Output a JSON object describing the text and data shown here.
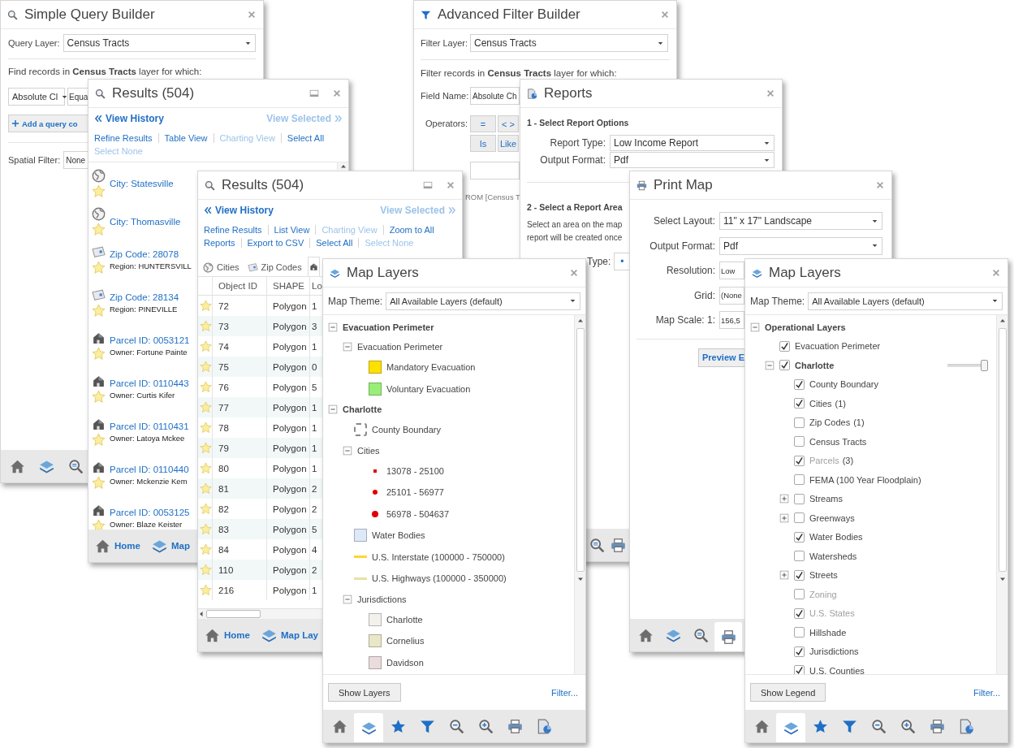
{
  "simple_query_builder": {
    "title": "Simple Query Builder",
    "layer_label": "Query Layer:",
    "layer": "Census Tracts",
    "intro": "Find records in **Census Tracts** layer for which:",
    "field": "Absolute Cl",
    "operator": "Equa",
    "add_button": "Add a query co",
    "spatial_label": "Spatial Filter:",
    "spatial": "None",
    "toolbar": [
      {
        "kind": "home",
        "selected": false
      },
      {
        "kind": "layers",
        "selected": false
      },
      {
        "kind": "zoom",
        "selected": false
      }
    ]
  },
  "results_list": {
    "title": "Results (504)",
    "history": "View History",
    "view_selected": "View Selected",
    "action_rows": [
      [
        {
          "label": "Refine Results",
          "disabled": false
        },
        {
          "label": "Table View",
          "disabled": false
        },
        {
          "label": "Charting View",
          "disabled": true
        },
        {
          "label": "Select All",
          "disabled": false
        }
      ],
      [
        {
          "label": "Select None",
          "disabled": true
        }
      ]
    ],
    "items": [
      {
        "kind": "city",
        "title": "City: Statesville"
      },
      {
        "kind": "city",
        "title": "City: Thomasville"
      },
      {
        "kind": "zip",
        "title": "Zip Code: 28078",
        "detail": "Region: HUNTERSVILL"
      },
      {
        "kind": "zip",
        "title": "Zip Code: 28134",
        "detail": "Region: PINEVILLE"
      },
      {
        "kind": "parcel",
        "title": "Parcel ID: 0053121",
        "detail": "Owner: Fortune Painte"
      },
      {
        "kind": "parcel",
        "title": "Parcel ID: 0110443",
        "detail": "Owner: Curtis Kifer"
      },
      {
        "kind": "parcel",
        "title": "Parcel ID: 0110431",
        "detail": "Owner: Latoya Mckee"
      },
      {
        "kind": "parcel",
        "title": "Parcel ID: 0110440",
        "detail": "Owner: Mckenzie Kem"
      },
      {
        "kind": "parcel",
        "title": "Parcel ID: 0053125",
        "detail": "Owner: Blaze Keister"
      }
    ],
    "toolbar": [
      {
        "kind": "home",
        "label": "Home"
      },
      {
        "kind": "layers",
        "label": "Map"
      }
    ]
  },
  "results_table": {
    "title": "Results (504)",
    "history": "View History",
    "view_selected": "View Selected",
    "action_rows": [
      [
        {
          "label": "Refine Results",
          "disabled": false
        },
        {
          "label": "List View",
          "disabled": false
        },
        {
          "label": "Charting View",
          "disabled": true
        },
        {
          "label": "Zoom to All",
          "disabled": false
        }
      ],
      [
        {
          "label": "Reports",
          "disabled": false
        },
        {
          "label": "Export to CSV",
          "disabled": false
        },
        {
          "label": "Select All",
          "disabled": false
        },
        {
          "label": "Select None",
          "disabled": true
        }
      ]
    ],
    "tabs": [
      {
        "kind": "city",
        "label": "Cities",
        "selected": false
      },
      {
        "kind": "zip",
        "label": "Zip Codes",
        "selected": false
      },
      {
        "kind": "parcel",
        "selected": true
      }
    ],
    "columns": [
      "Object ID",
      "SHAPE",
      "Lo"
    ],
    "rows": [
      [
        "72",
        "Polygon",
        "1"
      ],
      [
        "73",
        "Polygon",
        "3"
      ],
      [
        "74",
        "Polygon",
        "1"
      ],
      [
        "75",
        "Polygon",
        "0"
      ],
      [
        "76",
        "Polygon",
        "5"
      ],
      [
        "77",
        "Polygon",
        "1"
      ],
      [
        "78",
        "Polygon",
        "1"
      ],
      [
        "79",
        "Polygon",
        "1"
      ],
      [
        "80",
        "Polygon",
        "1"
      ],
      [
        "81",
        "Polygon",
        "2"
      ],
      [
        "82",
        "Polygon",
        "2"
      ],
      [
        "83",
        "Polygon",
        "5"
      ],
      [
        "84",
        "Polygon",
        "4"
      ],
      [
        "110",
        "Polygon",
        "2"
      ],
      [
        "216",
        "Polygon",
        "1"
      ]
    ],
    "toolbar": [
      {
        "kind": "home",
        "label": "Home"
      },
      {
        "kind": "layers",
        "label": "Map Lay"
      }
    ]
  },
  "advanced_filter_builder": {
    "title": "Advanced Filter Builder",
    "layer_label": "Filter Layer:",
    "layer": "Census Tracts",
    "intro": "Filter records in **Census Tracts** layer for which:",
    "field_label": "Field Name:",
    "field": "Absolute Ch",
    "operators_label": "Operators:",
    "operators": [
      "=",
      "< >",
      "Is",
      "Like"
    ],
    "expression": "ROM [Census T"
  },
  "reports": {
    "title": "Reports",
    "section_1": "1 - Select Report Options",
    "report_type_label": "Report Type:",
    "report_type": "Low Income Report",
    "format_label": "Output Format:",
    "format": "Pdf",
    "section_2": "2 - Select a Report Area",
    "instructions": [
      "Select an area on the map",
      "report will be created once"
    ],
    "type_label": "Type:",
    "type_value": "•",
    "toolbar": [
      {
        "kind": "zoom",
        "selected": false
      },
      {
        "kind": "print",
        "selected": false
      }
    ]
  },
  "print_map": {
    "title": "Print Map",
    "fields": [
      {
        "label": "Select Layout:",
        "value": "11\" x 17\" Landscape",
        "kind": "select"
      },
      {
        "label": "Output Format:",
        "value": "Pdf",
        "kind": "select"
      },
      {
        "label": "Resolution:",
        "value": "Low",
        "kind": "input"
      },
      {
        "label": "Grid:",
        "value": "(None",
        "kind": "input"
      },
      {
        "label": "Map Scale: 1:",
        "value": "156,5",
        "kind": "input"
      }
    ],
    "preview_button": "Preview E",
    "toolbar": [
      {
        "kind": "home",
        "selected": false
      },
      {
        "kind": "layers",
        "selected": false
      },
      {
        "kind": "zoom",
        "selected": false
      },
      {
        "kind": "print",
        "selected": true
      }
    ]
  },
  "map_layers_legend": {
    "title": "Map Layers",
    "theme_label": "Map Theme:",
    "theme": "All Available Layers (default)",
    "tree": [
      {
        "label": "Evacuation Perimeter",
        "expanded": true,
        "children": [
          {
            "label": "Evacuation Perimeter",
            "expanded": true,
            "children": [
              {
                "label": "Mandatory Evacuation",
                "symbol": {
                  "kind": "fill",
                  "color": "#ffe100"
                }
              },
              {
                "label": "Voluntary Evacuation",
                "symbol": {
                  "kind": "fill",
                  "color": "#99ee77"
                }
              }
            ]
          }
        ]
      },
      {
        "label": "Charlotte",
        "expanded": true,
        "children": [
          {
            "label": "County Boundary",
            "symbol": {
              "kind": "outline"
            }
          },
          {
            "label": "Cities",
            "expanded": true,
            "children": [
              {
                "label": "13078 - 25100",
                "symbol": {
                  "kind": "dot_small",
                  "color": "#e00000"
                }
              },
              {
                "label": "25101 - 56977",
                "symbol": {
                  "kind": "dot_medium",
                  "color": "#e00000"
                }
              },
              {
                "label": "56978 - 504637",
                "symbol": {
                  "kind": "dot_large",
                  "color": "#e00000"
                }
              }
            ]
          },
          {
            "label": "Water Bodies",
            "symbol": {
              "kind": "fill",
              "color": "#dde8f8"
            }
          },
          {
            "label": "U.S. Interstate (100000 - 750000)",
            "symbol": {
              "kind": "line",
              "color": "#ffd633"
            }
          },
          {
            "label": "U.S. Highways (100000 - 350000)",
            "symbol": {
              "kind": "line",
              "color": "#e6e2a8"
            }
          },
          {
            "label": "Jurisdictions",
            "expanded": true,
            "children": [
              {
                "label": "Charlotte",
                "symbol": {
                  "kind": "fill",
                  "color": "#f3f1ec"
                }
              },
              {
                "label": "Cornelius",
                "symbol": {
                  "kind": "fill",
                  "color": "#e9e7c8"
                }
              },
              {
                "label": "Davidson",
                "symbol": {
                  "kind": "fill",
                  "color": "#eadcdc"
                }
              }
            ]
          }
        ]
      }
    ],
    "show_button": "Show Layers",
    "filter_link": "Filter...",
    "toolbar": [
      {
        "kind": "home",
        "selected": false
      },
      {
        "kind": "layers",
        "selected": true
      },
      {
        "kind": "star",
        "selected": false
      },
      {
        "kind": "filter",
        "selected": false
      },
      {
        "kind": "zoom_out",
        "selected": false
      },
      {
        "kind": "zoom_in",
        "selected": false
      },
      {
        "kind": "print",
        "selected": false
      },
      {
        "kind": "report",
        "selected": false
      }
    ]
  },
  "map_layers_tree": {
    "title": "Map Layers",
    "theme_label": "Map Theme:",
    "theme": "All Available Layers (default)",
    "tree": [
      {
        "kind": "group",
        "label": "Operational Layers",
        "expanded": true,
        "children": [
          {
            "kind": "layer",
            "label": "Evacuation Perimeter",
            "checked": true,
            "disabled": false
          },
          {
            "kind": "layer",
            "label": "Charlotte",
            "checked": true,
            "disabled": false,
            "expanded": true,
            "slider": {
              "level": 1
            },
            "children": [
              {
                "kind": "layer",
                "label": "County Boundary",
                "checked": true,
                "disabled": false
              },
              {
                "kind": "layer",
                "label": "Cities",
                "count": "(1)",
                "checked": true,
                "disabled": false
              },
              {
                "kind": "layer",
                "label": "Zip Codes",
                "count": "(1)",
                "checked": false,
                "disabled": false
              },
              {
                "kind": "layer",
                "label": "Census Tracts",
                "checked": false,
                "disabled": false
              },
              {
                "kind": "layer",
                "label": "Parcels",
                "count": "(3)",
                "checked": true,
                "disabled": true
              },
              {
                "kind": "layer",
                "label": "FEMA (100 Year Floodplain)",
                "checked": false,
                "disabled": false
              },
              {
                "kind": "layer",
                "label": "Streams",
                "checked": false,
                "disabled": false,
                "expanded": false
              },
              {
                "kind": "layer",
                "label": "Greenways",
                "checked": false,
                "disabled": false,
                "expanded": false
              },
              {
                "kind": "layer",
                "label": "Water Bodies",
                "checked": true,
                "disabled": false
              },
              {
                "kind": "layer",
                "label": "Watersheds",
                "checked": false,
                "disabled": false
              },
              {
                "kind": "layer",
                "label": "Streets",
                "checked": true,
                "disabled": false,
                "expanded": false
              },
              {
                "kind": "layer",
                "label": "Zoning",
                "checked": false,
                "disabled": true
              },
              {
                "kind": "layer",
                "label": "U.S. States",
                "checked": true,
                "disabled": true
              },
              {
                "kind": "layer",
                "label": "Hillshade",
                "checked": false,
                "disabled": false
              },
              {
                "kind": "layer",
                "label": "Jurisdictions",
                "checked": true,
                "disabled": false
              },
              {
                "kind": "layer",
                "label": "U.S. Counties",
                "checked": true,
                "disabled": false
              }
            ]
          }
        ]
      }
    ],
    "show_button": "Show Legend",
    "filter_link": "Filter...",
    "toolbar": [
      {
        "kind": "home",
        "selected": false
      },
      {
        "kind": "layers",
        "selected": true
      },
      {
        "kind": "star",
        "selected": false
      },
      {
        "kind": "filter",
        "selected": false
      },
      {
        "kind": "zoom_out",
        "selected": false
      },
      {
        "kind": "zoom_in",
        "selected": false
      },
      {
        "kind": "print",
        "selected": false
      },
      {
        "kind": "report",
        "selected": false
      }
    ]
  }
}
